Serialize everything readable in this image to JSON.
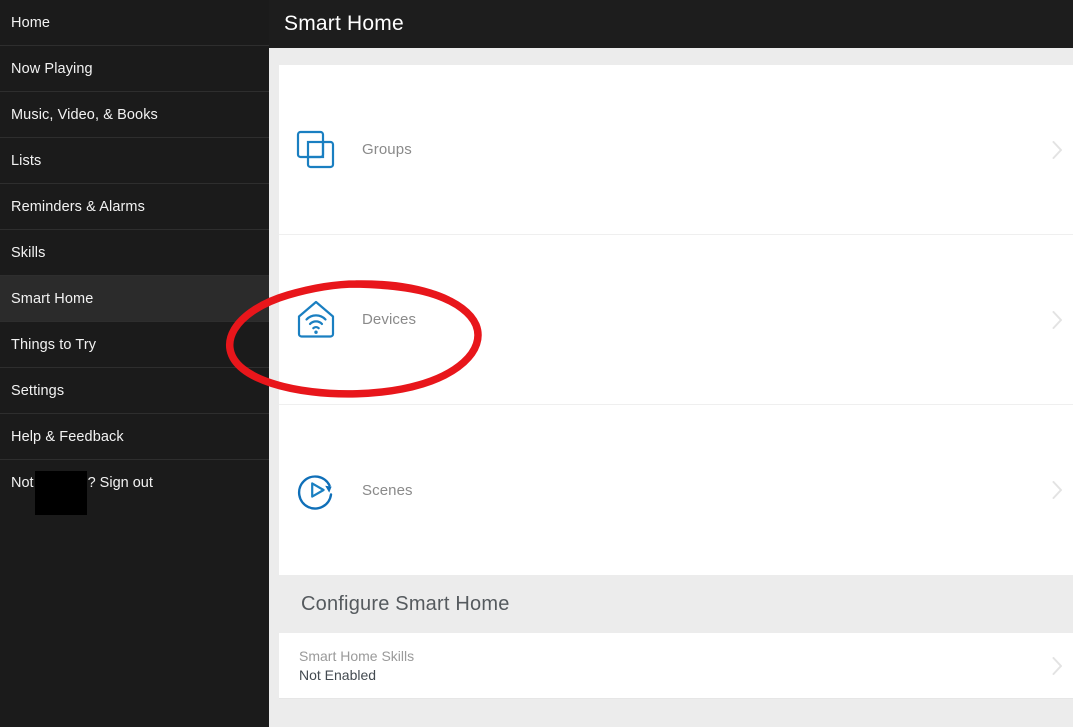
{
  "app": {
    "header_title": "Smart Home",
    "accent_blue": "#0f7ac0",
    "annotation_color": "#e8161b",
    "sidebar_bg": "#1b1b1b",
    "sidebar_selected_bg": "#2b2b2b",
    "page_bg": "#ececec"
  },
  "sidebar": {
    "items": [
      {
        "label": "Home",
        "selected": false
      },
      {
        "label": "Now Playing",
        "selected": false
      },
      {
        "label": "Music, Video, & Books",
        "selected": false
      },
      {
        "label": "Lists",
        "selected": false
      },
      {
        "label": "Reminders & Alarms",
        "selected": false
      },
      {
        "label": "Skills",
        "selected": false
      },
      {
        "label": "Smart Home",
        "selected": true
      },
      {
        "label": "Things to Try",
        "selected": false
      },
      {
        "label": "Settings",
        "selected": false
      },
      {
        "label": "Help & Feedback",
        "selected": false
      }
    ],
    "signout": {
      "prefix": "Not",
      "redacted_user": "",
      "suffix": "? Sign out",
      "link_label": "Sign out"
    }
  },
  "main": {
    "features": [
      {
        "label": "Groups",
        "icon": "groups-icon",
        "chevron": "chevron-right-icon"
      },
      {
        "label": "Devices",
        "icon": "devices-home-wifi-icon",
        "chevron": "chevron-right-icon"
      },
      {
        "label": "Scenes",
        "icon": "scenes-play-refresh-icon",
        "chevron": "chevron-right-icon"
      }
    ],
    "configure": {
      "section_title": "Configure Smart Home",
      "rows": [
        {
          "title": "Smart Home Skills",
          "value": "Not Enabled",
          "chevron": "chevron-right-icon"
        }
      ]
    }
  },
  "annotation": {
    "type": "hand-drawn-ellipse",
    "target": "Devices",
    "color": "#e8161b"
  }
}
